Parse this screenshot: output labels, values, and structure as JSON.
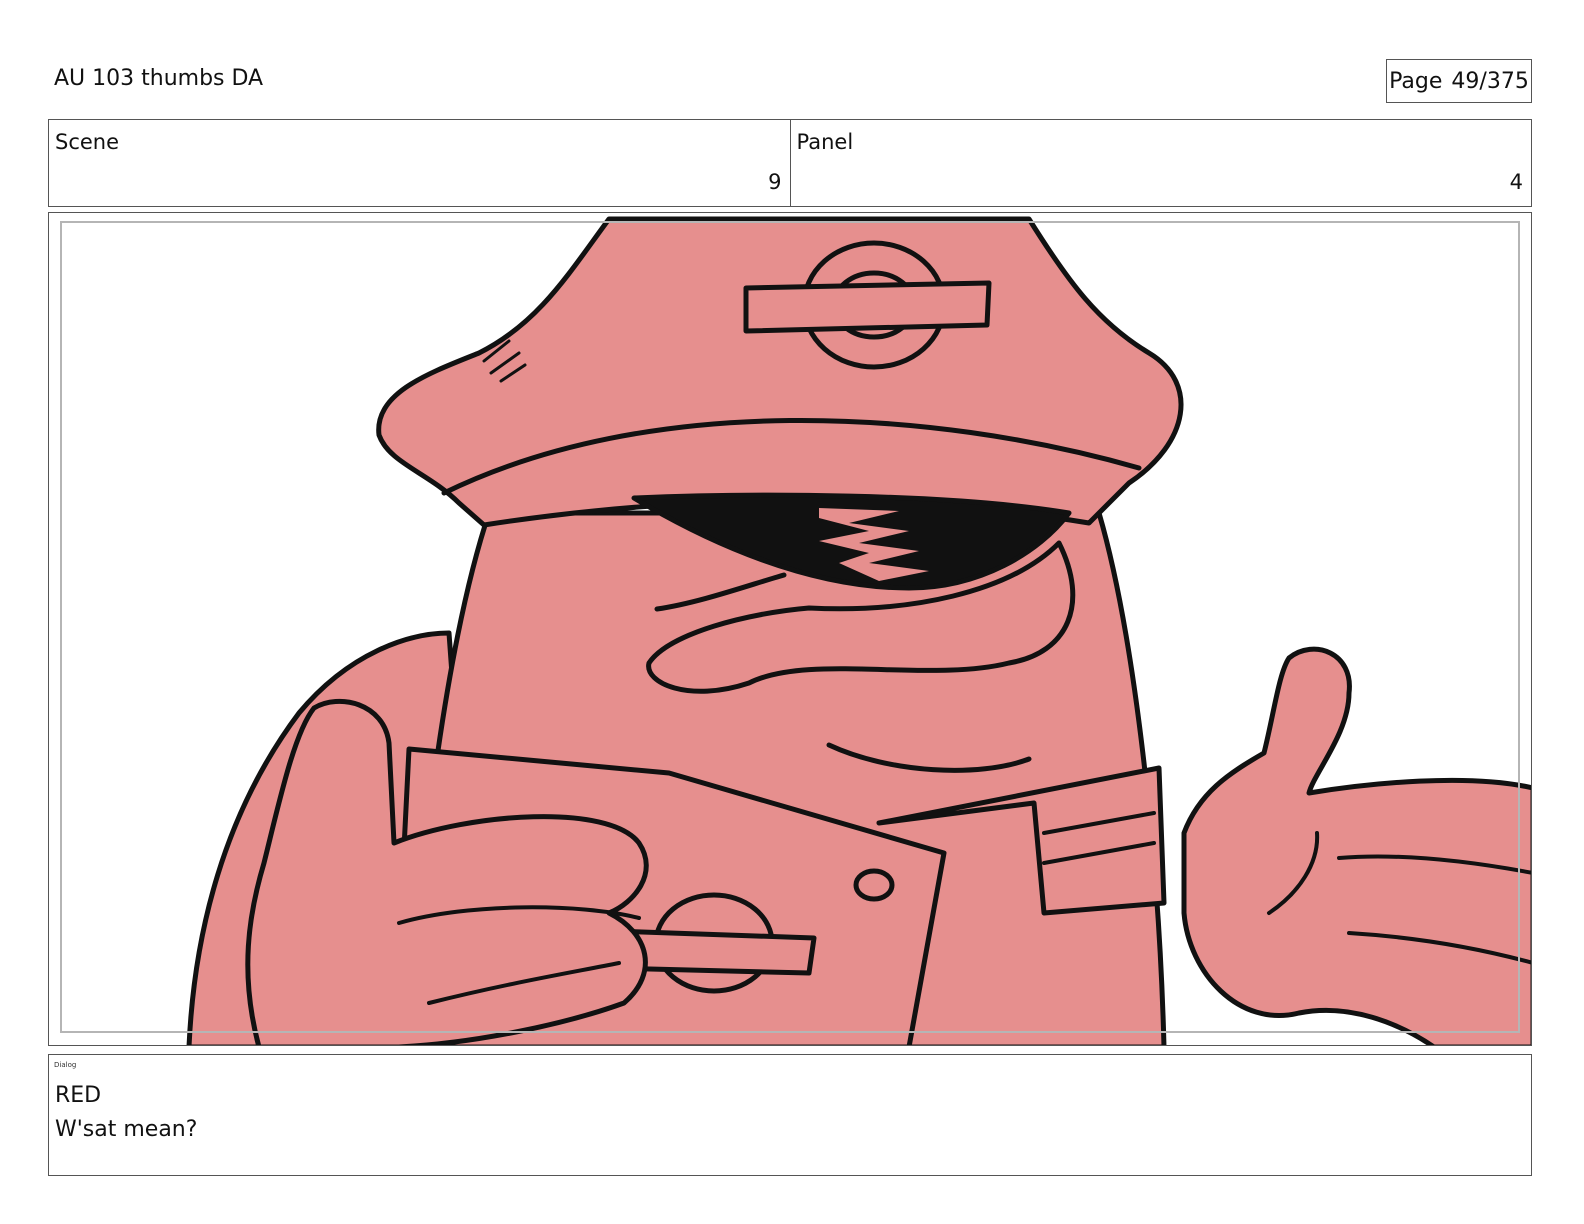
{
  "header": {
    "title": "AU 103 thumbs DA",
    "page_label": "Page",
    "page_value": "49/375"
  },
  "info": {
    "scene_label": "Scene",
    "scene_value": "9",
    "panel_label": "Panel",
    "panel_value": "4"
  },
  "panel": {
    "fill_color": "#e68f8e",
    "line_color": "#111111"
  },
  "dialog": {
    "label": "Dialog",
    "speaker": "RED",
    "line": "W'sat mean?"
  }
}
